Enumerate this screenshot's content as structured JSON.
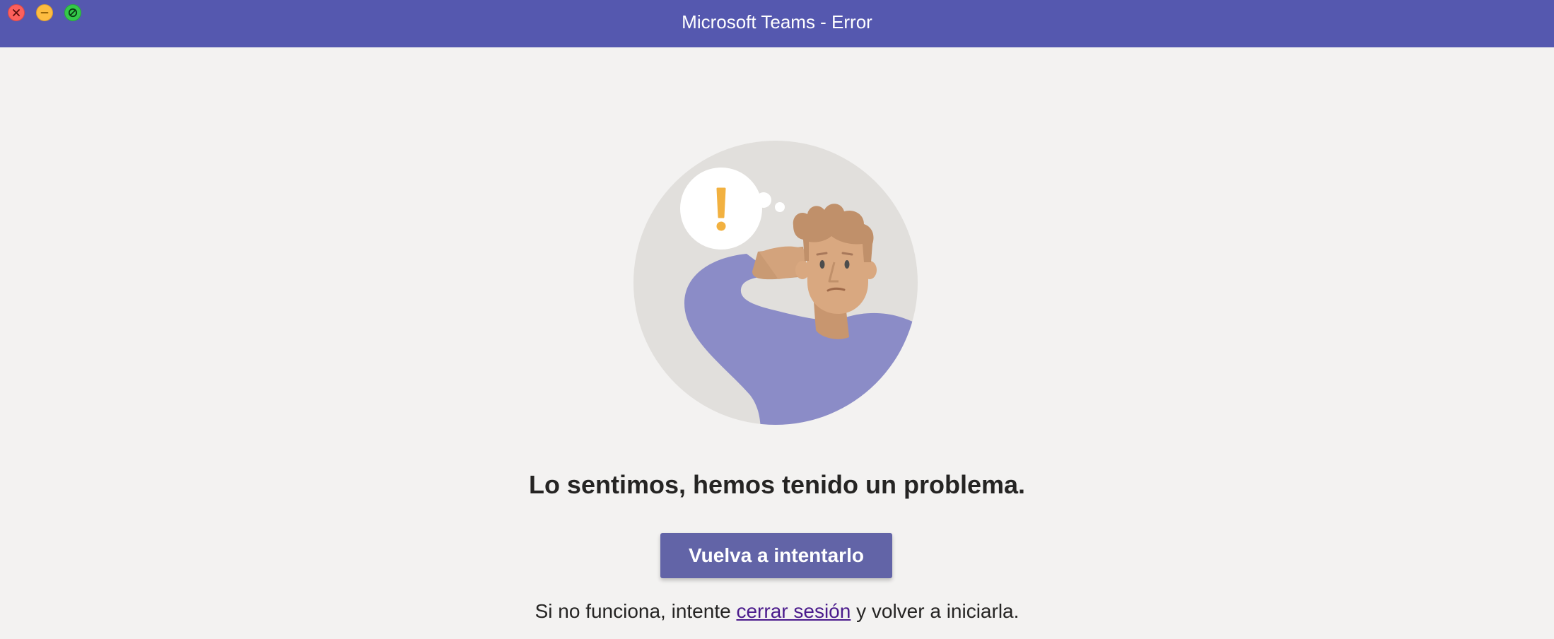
{
  "window": {
    "title": "Microsoft Teams - Error",
    "controls": {
      "close_icon": "close-icon",
      "minimize_icon": "minimize-icon",
      "maximize_icon": "maximize-icon"
    },
    "colors": {
      "titlebar": "#5558af",
      "background": "#f3f2f1"
    }
  },
  "illustration": {
    "icon": "exclamation-icon",
    "description_role": "error-illustration",
    "colors": {
      "circle": "#e1dfdc",
      "shirt": "#8b8cc7",
      "skin": "#d9a880",
      "hair": "#c0906a",
      "exclamation": "#f2b140"
    }
  },
  "error": {
    "heading": "Lo sentimos, hemos tenido un problema.",
    "retry_label": "Vuelva a intentarlo",
    "hint_prefix": "Si no funciona, intente ",
    "hint_link": "cerrar sesión",
    "hint_suffix": " y volver a iniciarla.",
    "colors": {
      "button": "#6264a7",
      "link": "#4b1b8c"
    }
  }
}
